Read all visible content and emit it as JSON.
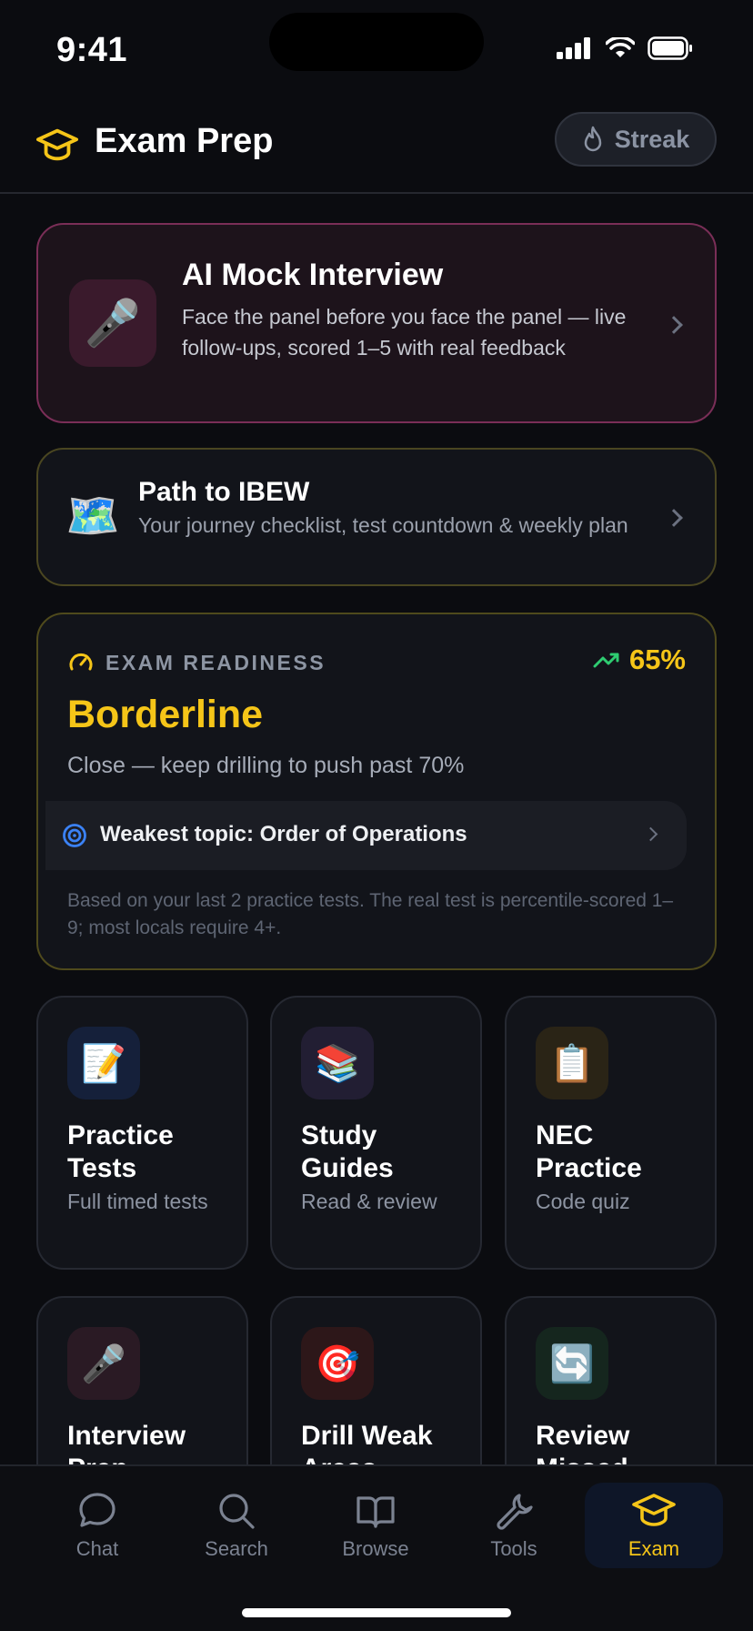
{
  "status_bar": {
    "time": "9:41"
  },
  "header": {
    "title": "Exam Prep",
    "streak_label": "Streak"
  },
  "mock_interview": {
    "title": "AI Mock Interview",
    "description": "Face the panel before you face the panel — live follow-ups, scored 1–5 with real feedback",
    "icon": "🎤"
  },
  "path": {
    "title": "Path to IBEW",
    "description": "Your journey checklist, test countdown & weekly plan",
    "icon": "🗺️"
  },
  "readiness": {
    "label": "EXAM READINESS",
    "percent": "65%",
    "status": "Borderline",
    "subtitle": "Close — keep drilling to push past 70%",
    "weakest": "Weakest topic: Order of Operations",
    "note": "Based on your last 2 practice tests. The real test is percentile-scored 1–9; most locals require 4+."
  },
  "tiles": [
    {
      "title": "Practice Tests",
      "subtitle": "Full timed tests",
      "icon": "📝",
      "color": "#15203a"
    },
    {
      "title": "Study Guides",
      "subtitle": "Read & review",
      "icon": "📚",
      "color": "#221e33"
    },
    {
      "title": "NEC Practice",
      "subtitle": "Code quiz",
      "icon": "📋",
      "color": "#2a2416"
    },
    {
      "title": "Interview Prep",
      "subtitle": "",
      "icon": "🎤",
      "color": "#2a1a24"
    },
    {
      "title": "Drill Weak Areas",
      "subtitle": "",
      "icon": "🎯",
      "color": "#2d1719"
    },
    {
      "title": "Review Missed",
      "subtitle": "",
      "icon": "🔄",
      "color": "#15261e"
    }
  ],
  "tabbar": {
    "tabs": [
      {
        "label": "Chat"
      },
      {
        "label": "Search"
      },
      {
        "label": "Browse"
      },
      {
        "label": "Tools"
      },
      {
        "label": "Exam"
      }
    ],
    "active": "Exam"
  },
  "colors": {
    "accent": "#f5c518",
    "background": "#0b0c10"
  }
}
